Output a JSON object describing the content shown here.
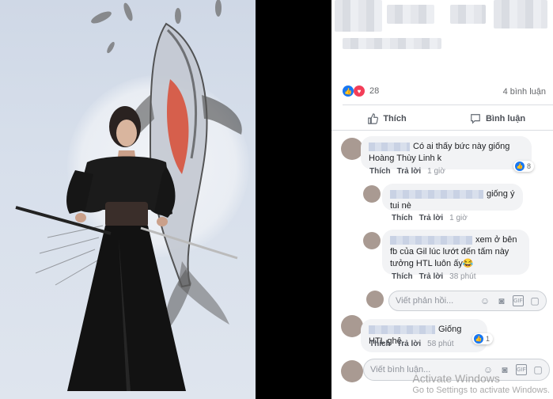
{
  "post": {
    "reaction_count": "28",
    "comment_count_label": "4 bình luận",
    "like_label": "Thích",
    "comment_label": "Bình luận"
  },
  "comments": [
    {
      "text": "Có ai thấy bức này giống Hoàng Thùy Linh k",
      "like": "Thích",
      "reply": "Trả lời",
      "time": "1 giờ",
      "reactions": "8"
    },
    {
      "text": "giống ý tui nè",
      "like": "Thích",
      "reply": "Trả lời",
      "time": "1 giờ"
    },
    {
      "text": "xem ở bên fb của Gil lúc lướt đến tấm này tưởng HTL luôn ấy",
      "emoji": "😂",
      "like": "Thích",
      "reply": "Trả lời",
      "time": "38 phút"
    },
    {
      "text": "Giống HTL ghê",
      "like": "Thích",
      "reply": "Trả lời",
      "time": "58 phút",
      "reactions": "1"
    }
  ],
  "reply_box": {
    "placeholder": "Viết phản hồi..."
  },
  "comment_box": {
    "placeholder": "Viết bình luận..."
  },
  "watermark": {
    "line1": "Activate Windows",
    "line2": "Go to Settings to activate Windows."
  },
  "colors": {
    "facebook_blue": "#1877f2",
    "love_red": "#f33e58",
    "bubble": "#f2f3f5"
  },
  "icons": [
    "like-icon",
    "love-icon",
    "thumb-icon",
    "speech-bubble-icon",
    "emoji-icon",
    "camera-icon",
    "gif-icon",
    "sticker-icon"
  ]
}
